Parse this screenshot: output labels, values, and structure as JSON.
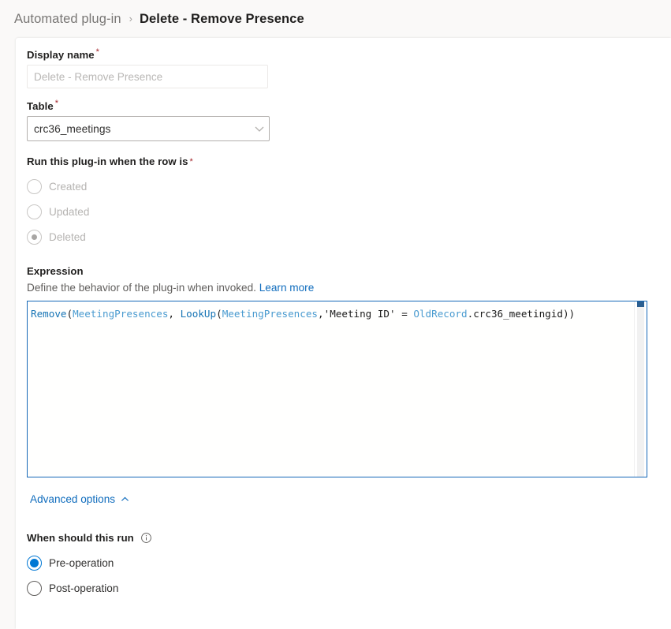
{
  "breadcrumb": {
    "parent": "Automated plug-in",
    "separator": "›",
    "current": "Delete - Remove Presence"
  },
  "form": {
    "display_name": {
      "label": "Display name",
      "required_marker": "*",
      "value": "",
      "placeholder": "Delete - Remove Presence"
    },
    "table": {
      "label": "Table",
      "required_marker": "*",
      "selected": "crc36_meetings",
      "chevron_icon": "chevron-down-icon"
    },
    "trigger": {
      "label": "Run this plug-in when the row is",
      "required_marker": "*",
      "selected": "Deleted",
      "disabled": true,
      "options": [
        {
          "label": "Created",
          "checked": false
        },
        {
          "label": "Updated",
          "checked": false
        },
        {
          "label": "Deleted",
          "checked": true
        }
      ]
    },
    "expression": {
      "title": "Expression",
      "description": "Define the behavior of the plug-in when invoked.",
      "learn_more": "Learn more",
      "formula": "Remove(MeetingPresences, LookUp(MeetingPresences,'Meeting ID' = OldRecord.crc36_meetingid))",
      "tokens": [
        {
          "t": "Remove",
          "c": "tok-fn"
        },
        {
          "t": "(",
          "c": "tok-punct"
        },
        {
          "t": "MeetingPresences",
          "c": "tok-ident"
        },
        {
          "t": ", ",
          "c": "tok-punct"
        },
        {
          "t": "LookUp",
          "c": "tok-fn"
        },
        {
          "t": "(",
          "c": "tok-punct"
        },
        {
          "t": "MeetingPresences",
          "c": "tok-ident"
        },
        {
          "t": ",",
          "c": "tok-punct"
        },
        {
          "t": "'Meeting ID'",
          "c": "tok-str"
        },
        {
          "t": " = ",
          "c": "tok-op"
        },
        {
          "t": "OldRecord",
          "c": "tok-ident"
        },
        {
          "t": ".crc36_meetingid",
          "c": "tok-punct"
        },
        {
          "t": "))",
          "c": "tok-punct"
        }
      ]
    },
    "advanced_options": {
      "label": "Advanced options",
      "chevron_icon": "chevron-up-icon",
      "expanded": true
    },
    "when_should_run": {
      "label": "When should this run",
      "info_icon": "info-icon",
      "selected": "Pre-operation",
      "options": [
        {
          "label": "Pre-operation",
          "checked": true
        },
        {
          "label": "Post-operation",
          "checked": false
        }
      ]
    }
  },
  "colors": {
    "page_background": "#faf9f8",
    "card_background": "#ffffff",
    "accent": "#0078d4",
    "link": "#0f6cbd",
    "required_star": "#a4262c",
    "focus_border": "#1668b8",
    "text_primary": "#201f1e",
    "text_secondary": "#605e5c",
    "text_disabled": "#b6b4b2"
  }
}
